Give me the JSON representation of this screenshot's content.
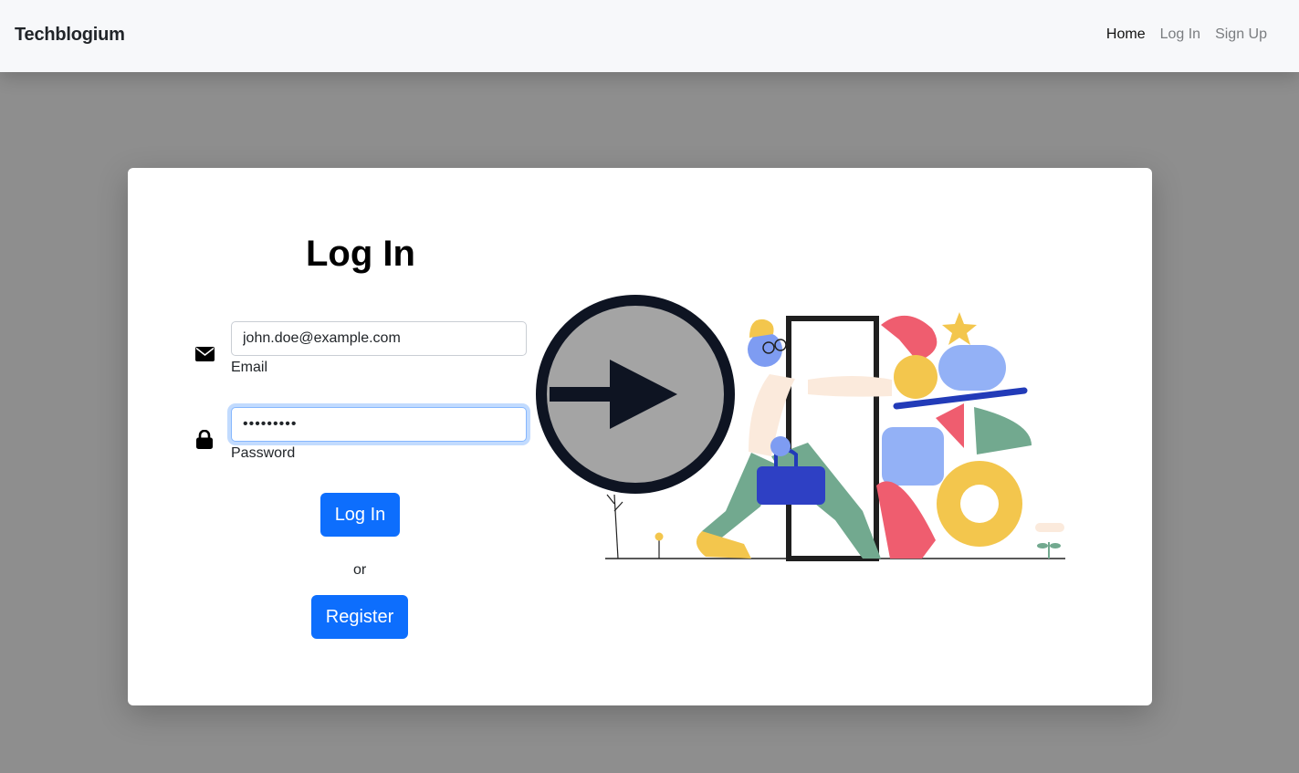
{
  "navbar": {
    "brand": "Techblogium",
    "links": [
      {
        "label": "Home",
        "active": true
      },
      {
        "label": "Log In",
        "active": false
      },
      {
        "label": "Sign Up",
        "active": false
      }
    ]
  },
  "form": {
    "title": "Log In",
    "email": {
      "value": "john.doe@example.com",
      "label": "Email",
      "icon": "envelope-icon"
    },
    "password": {
      "value": "•••••••••",
      "label": "Password",
      "icon": "lock-icon"
    },
    "login_label": "Log In",
    "or_label": "or",
    "register_label": "Register"
  },
  "colors": {
    "primary": "#0d6efd",
    "navbar_bg": "#f7f8fa",
    "page_bg": "#8e8e8e",
    "card_bg": "#ffffff"
  },
  "illustration": {
    "overlay_icon": "sign-in-arrow-icon",
    "scene": "person-entering-door-illustration"
  }
}
